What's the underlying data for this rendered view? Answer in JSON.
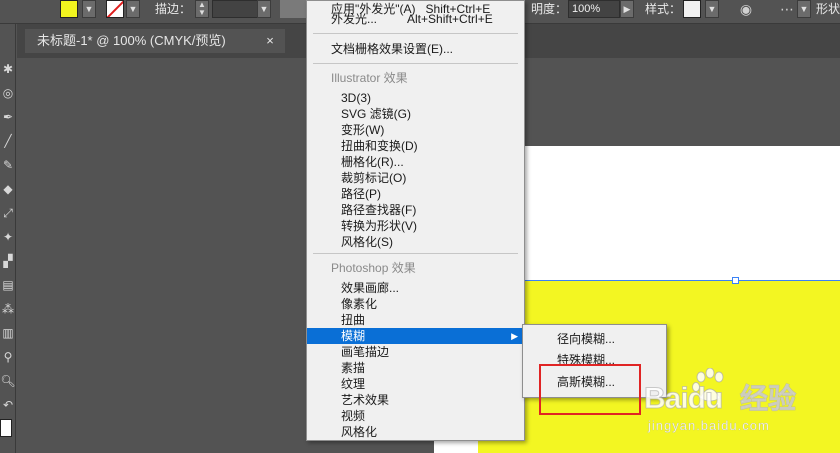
{
  "toolbar_top": {
    "stroke_label": "描边：",
    "opacity_label": "明度：",
    "opacity_value": "100%",
    "style_label": "样式：",
    "shape_label": "形状",
    "fill_color": "#f2f51f"
  },
  "document": {
    "tab_title": "未标题-1* @ 100% (CMYK/预览)",
    "close": "×"
  },
  "effect_menu": {
    "top_items": [
      {
        "label": "外发光...",
        "shortcut": "Alt+Shift+Ctrl+E"
      }
    ],
    "document_raster_settings": "文档栅格效果设置(E)...",
    "illustrator_header": "Illustrator 效果",
    "illustrator_items": [
      "3D(3)",
      "SVG 滤镜(G)",
      "变形(W)",
      "扭曲和变换(D)",
      "栅格化(R)...",
      "裁剪标记(O)",
      "路径(P)",
      "路径查找器(F)",
      "转换为形状(V)",
      "风格化(S)"
    ],
    "photoshop_header": "Photoshop 效果",
    "photoshop_items": [
      "效果画廊...",
      "像素化",
      "扭曲",
      "模糊",
      "画笔描边",
      "素描",
      "纹理",
      "艺术效果",
      "视频",
      "风格化"
    ],
    "highlighted": "模糊"
  },
  "blur_submenu": {
    "items": [
      "径向模糊...",
      "特殊模糊...",
      "高斯模糊..."
    ]
  },
  "watermark": {
    "logo": "Baidu",
    "cn": "经验",
    "url": "jingyan.baidu.com"
  }
}
